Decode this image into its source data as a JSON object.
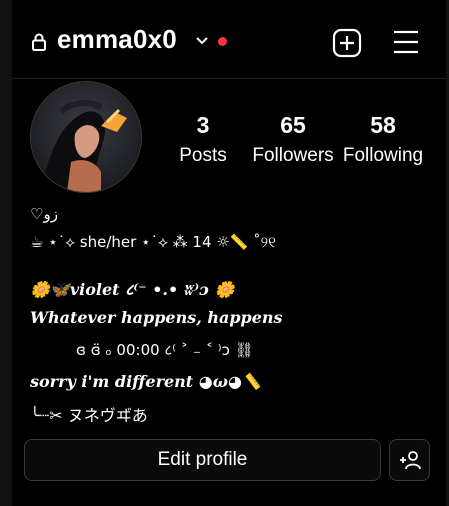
{
  "header": {
    "username": "emma0x0",
    "icons": [
      "lock-icon",
      "chevron-down-icon",
      "notification-dot",
      "new-post-icon",
      "menu-icon"
    ],
    "accent_dot_color": "#ff3040"
  },
  "profile": {
    "avatar": "avatar-image",
    "stats": [
      {
        "value": "3",
        "label": "Posts"
      },
      {
        "value": "65",
        "label": "Followers"
      },
      {
        "value": "58",
        "label": "Following"
      }
    ]
  },
  "bio": {
    "line1": "♡زو",
    "line2": "☕ ⋆˙⟡ she/her ⋆˙⟡ ⁂ 14 ☼📏 ˚୨୧",
    "line3": "🌼🦋violet ८⁽⁻ •.• ʬ⁾ɔ 🌼",
    "line4": "Whatever happens, happens",
    "line5": "ɞ ɞ̈ ₒ 00:00 ८⁽ ˃ ₋ ˂ ⁾ɔ ⛓",
    "line6": "sorry i'm different ◕ω◕📏",
    "line7": "╰┈✂ ヌネヴヸあ"
  },
  "actions": {
    "edit_profile_label": "Edit profile",
    "add_person_icon": "add-person-icon"
  }
}
